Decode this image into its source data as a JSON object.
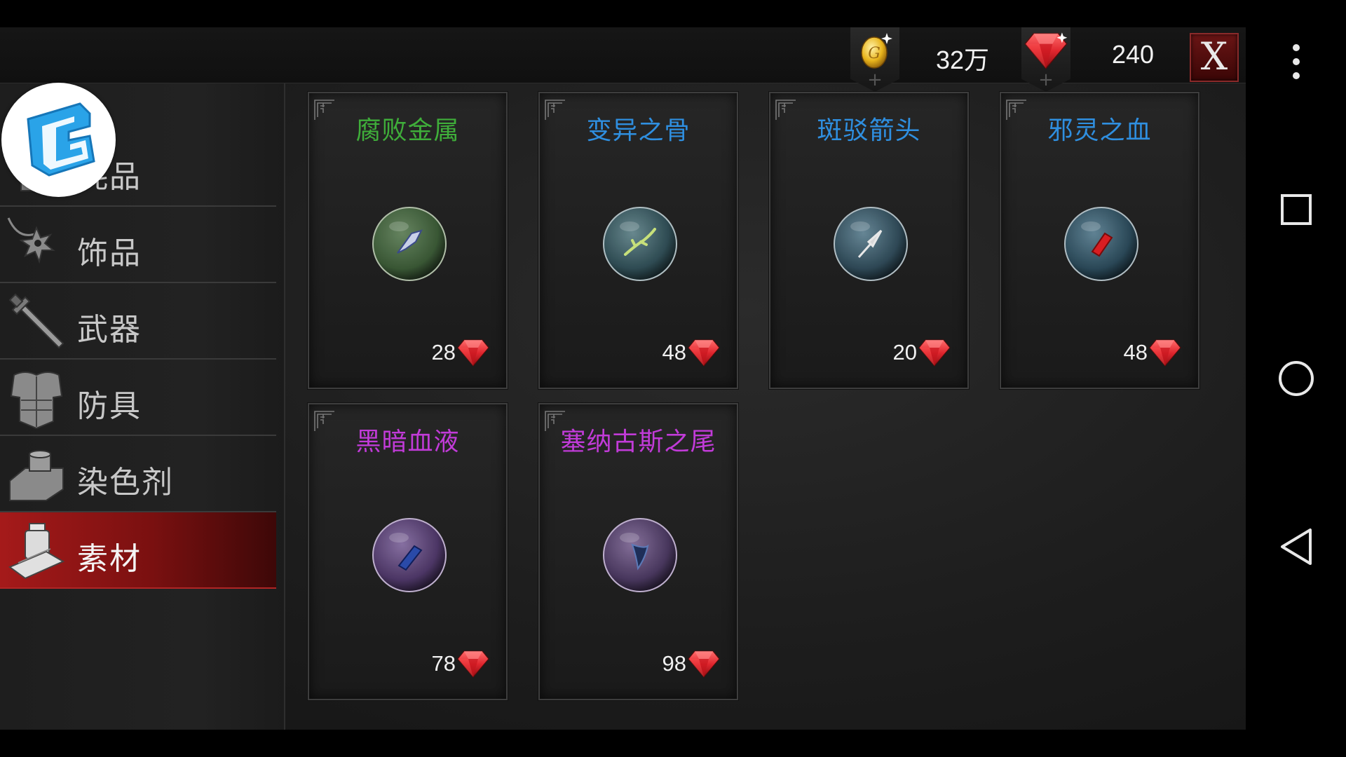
{
  "currency": {
    "gold_amount": "32万",
    "gem_amount": "240",
    "plus_symbol": "+"
  },
  "close_label": "X",
  "categories": [
    {
      "label": "耗品",
      "icon": "potion-icon",
      "active": false
    },
    {
      "label": "饰品",
      "icon": "necklace-icon",
      "active": false
    },
    {
      "label": "武器",
      "icon": "sword-icon",
      "active": false
    },
    {
      "label": "防具",
      "icon": "armor-icon",
      "active": false
    },
    {
      "label": "染色剂",
      "icon": "dye-icon",
      "active": false
    },
    {
      "label": "素材",
      "icon": "materials-icon",
      "active": true
    }
  ],
  "items": [
    {
      "name": "腐败金属",
      "color": "#3fae3a",
      "price": "28",
      "orb_tint": "#3b5a36",
      "content_icon": "metal-shard-icon"
    },
    {
      "name": "变异之骨",
      "color": "#2f8fe0",
      "price": "48",
      "orb_tint": "#2f4d55",
      "content_icon": "bone-icon"
    },
    {
      "name": "斑驳箭头",
      "color": "#2f8fe0",
      "price": "20",
      "orb_tint": "#2f4a58",
      "content_icon": "arrowhead-icon"
    },
    {
      "name": "邪灵之血",
      "color": "#2f8fe0",
      "price": "48",
      "orb_tint": "#2b4a5a",
      "content_icon": "blood-vial-icon"
    },
    {
      "name": "黑暗血液",
      "color": "#c13bd8",
      "price": "78",
      "orb_tint": "#4e3768",
      "content_icon": "dark-blood-icon"
    },
    {
      "name": "塞纳古斯之尾",
      "color": "#c13bd8",
      "price": "98",
      "orb_tint": "#4a3860",
      "content_icon": "tail-icon"
    }
  ],
  "colors": {
    "accent_red": "#a51a1a",
    "gem_red": "#e0262e",
    "gold": "#e8b41c"
  },
  "icons": {
    "gold": "gold-coin-icon",
    "gem": "ruby-gem-icon",
    "logo": "app-logo-icon",
    "menu": "more-vert-icon",
    "recents": "recents-square-icon",
    "home": "home-circle-icon",
    "back": "back-triangle-icon"
  }
}
